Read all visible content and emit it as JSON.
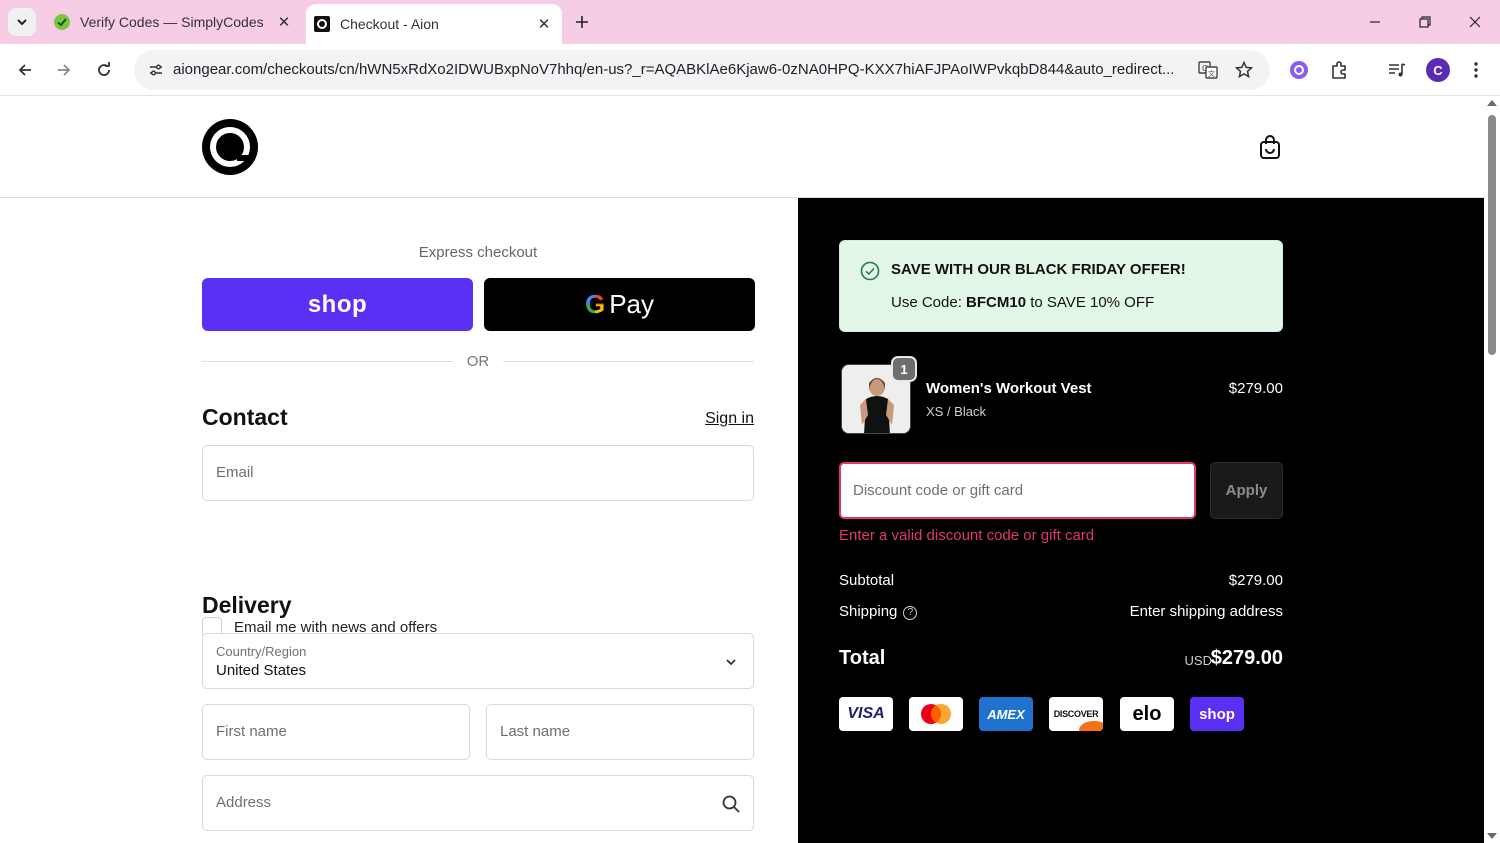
{
  "browser": {
    "tabs": [
      {
        "title": "Verify Codes — SimplyCodes",
        "active": false
      },
      {
        "title": "Checkout - Aion",
        "active": true
      }
    ],
    "url": "aiongear.com/checkouts/cn/hWN5xRdXo2IDWUBxpNoV7hhq/en-us?_r=AQABKlAe6Kjaw6-0zNA0HPQ-KXX7hiAFJPAoIWPvkqbD844&auto_redirect...",
    "profile_initial": "C",
    "tabbar_color": "#f6cde4"
  },
  "checkout": {
    "express_label": "Express checkout",
    "shop_pay_label": "shop",
    "gpay_label": "Pay",
    "or_label": "OR",
    "contact_title": "Contact",
    "sign_in": "Sign in",
    "email_placeholder": "Email",
    "newsletter_label": "Email me with news and offers",
    "delivery_title": "Delivery",
    "country_label": "Country/Region",
    "country_value": "United States",
    "first_name_placeholder": "First name",
    "last_name_placeholder": "Last name",
    "address_placeholder": "Address"
  },
  "summary": {
    "offer_title": "SAVE WITH OUR BLACK FRIDAY OFFER!",
    "offer_prefix": "Use Code:",
    "offer_code": "BFCM10",
    "offer_suffix": "to SAVE 10% OFF",
    "product": {
      "quantity": "1",
      "name": "Women's Workout Vest",
      "variant": "XS / Black",
      "price": "$279.00"
    },
    "discount_placeholder": "Discount code or gift card",
    "apply_label": "Apply",
    "discount_error": "Enter a valid discount code or gift card",
    "subtotal_label": "Subtotal",
    "subtotal_value": "$279.00",
    "shipping_label": "Shipping",
    "shipping_value": "Enter shipping address",
    "total_label": "Total",
    "total_currency": "USD",
    "total_value": "$279.00",
    "payment_methods": [
      "VISA",
      "Mastercard",
      "AMEX",
      "DISCOVER",
      "elo",
      "shop"
    ],
    "accent_error": "#e0386a",
    "offer_bg": "#e3f7e8",
    "shop_pay_color": "#5a31f4"
  }
}
